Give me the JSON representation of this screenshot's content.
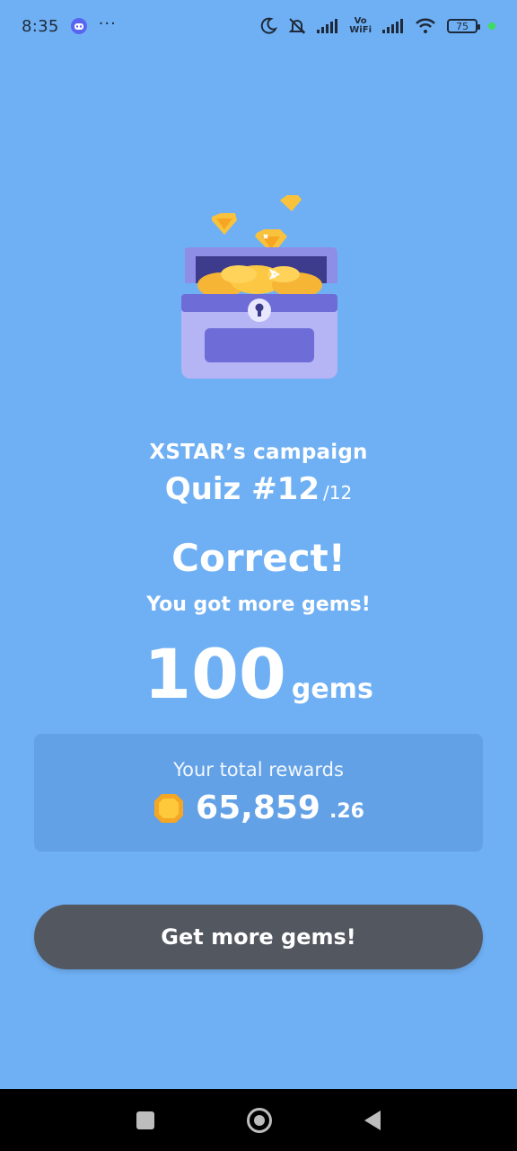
{
  "status_bar": {
    "time": "8:35",
    "overflow": "···",
    "vowifi_top": "Vo",
    "vowifi_bottom": "WiFi",
    "battery": "75",
    "icons": [
      "discord-icon",
      "moon-icon",
      "bell-off-icon",
      "signal-icon",
      "wifi-icon",
      "battery-icon"
    ]
  },
  "campaign": {
    "title": "XSTAR’s campaign",
    "quiz_label": "Quiz #12",
    "quiz_total": "/12"
  },
  "result": {
    "headline": "Correct!",
    "subline": "You got more gems!",
    "gems_amount": "100",
    "gems_unit": "gems"
  },
  "rewards": {
    "label": "Your total rewards",
    "total_main": "65,859",
    "total_decimal": ".26"
  },
  "cta": {
    "label": "Get more gems!"
  },
  "colors": {
    "background": "#6fb0f4",
    "button": "#525760",
    "gem": "#f7b730"
  }
}
